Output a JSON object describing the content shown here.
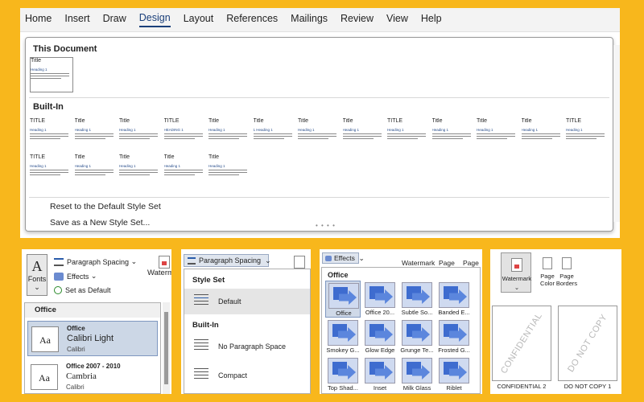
{
  "ribbon": {
    "tabs": [
      "Home",
      "Insert",
      "Draw",
      "Design",
      "Layout",
      "References",
      "Mailings",
      "Review",
      "View",
      "Help"
    ],
    "active_tab": "Design"
  },
  "style_gallery": {
    "this_document_label": "This Document",
    "built_in_label": "Built-In",
    "this_document_thumb": {
      "title": "Title",
      "heading": "Heading 1"
    },
    "built_in_row1": [
      {
        "title": "TITLE",
        "heading": "Heading 1"
      },
      {
        "title": "Title",
        "heading": "Heading 1"
      },
      {
        "title": "Title",
        "heading": "Heading 1"
      },
      {
        "title": "TITLE",
        "heading": "HEADING 1"
      },
      {
        "title": "Title",
        "heading": "Heading 1"
      },
      {
        "title": "Title",
        "heading": "1 Heading 1"
      },
      {
        "title": "Title",
        "heading": "Heading 1"
      },
      {
        "title": "Title",
        "heading": "Heading 1"
      },
      {
        "title": "TITLE",
        "heading": "Heading 1"
      },
      {
        "title": "Title",
        "heading": "Heading 1"
      },
      {
        "title": "Title",
        "heading": "Heading 1"
      },
      {
        "title": "Title",
        "heading": "Heading 1"
      },
      {
        "title": "TITLE",
        "heading": "Heading 1"
      }
    ],
    "built_in_row2": [
      {
        "title": "TITLE",
        "heading": "Heading 1"
      },
      {
        "title": "Title",
        "heading": "Heading 1"
      },
      {
        "title": "Title",
        "heading": "Heading 1"
      },
      {
        "title": "Title",
        "heading": "Heading 1"
      },
      {
        "title": "Title",
        "heading": "Heading 1"
      }
    ],
    "commands": [
      "Reset to the Default Style Set",
      "Save as a New Style Set..."
    ]
  },
  "panel_fonts": {
    "fonts_label": "Fonts",
    "paragraph_spacing_label": "Paragraph Spacing",
    "effects_label": "Effects",
    "set_default_label": "Set as Default",
    "watermark_label": "Waterm",
    "dropdown_header": "Office",
    "items": [
      {
        "name": "Office",
        "heading_font": "Calibri Light",
        "body_font": "Calibri",
        "sample": "Aa"
      },
      {
        "name": "Office 2007 - 2010",
        "heading_font": "Cambria",
        "body_font": "Calibri",
        "sample": "Aa"
      }
    ]
  },
  "panel_spacing": {
    "button_label": "Paragraph Spacing",
    "style_set_header": "Style Set",
    "built_in_header": "Built-In",
    "items": [
      "Default",
      "No Paragraph Space",
      "Compact"
    ]
  },
  "panel_effects": {
    "button_label": "Effects",
    "top_labels": [
      "Watermark",
      "Page",
      "Page"
    ],
    "header": "Office",
    "tiles": [
      "Office",
      "Office 20...",
      "Subtle So...",
      "Banded E...",
      "Smokey G...",
      "Glow Edge",
      "Grunge Te...",
      "Frosted G...",
      "Top Shad...",
      "Inset",
      "Milk Glass",
      "Riblet"
    ]
  },
  "panel_watermark": {
    "watermark_label": "Watermark",
    "page_color_label": "Page Color",
    "page_borders_label": "Page Borders",
    "samples": [
      {
        "text": "CONFIDENTIAL",
        "caption": "CONFIDENTIAL 2"
      },
      {
        "text": "DO NOT COPY",
        "caption": "DO NOT COPY 1"
      }
    ]
  }
}
